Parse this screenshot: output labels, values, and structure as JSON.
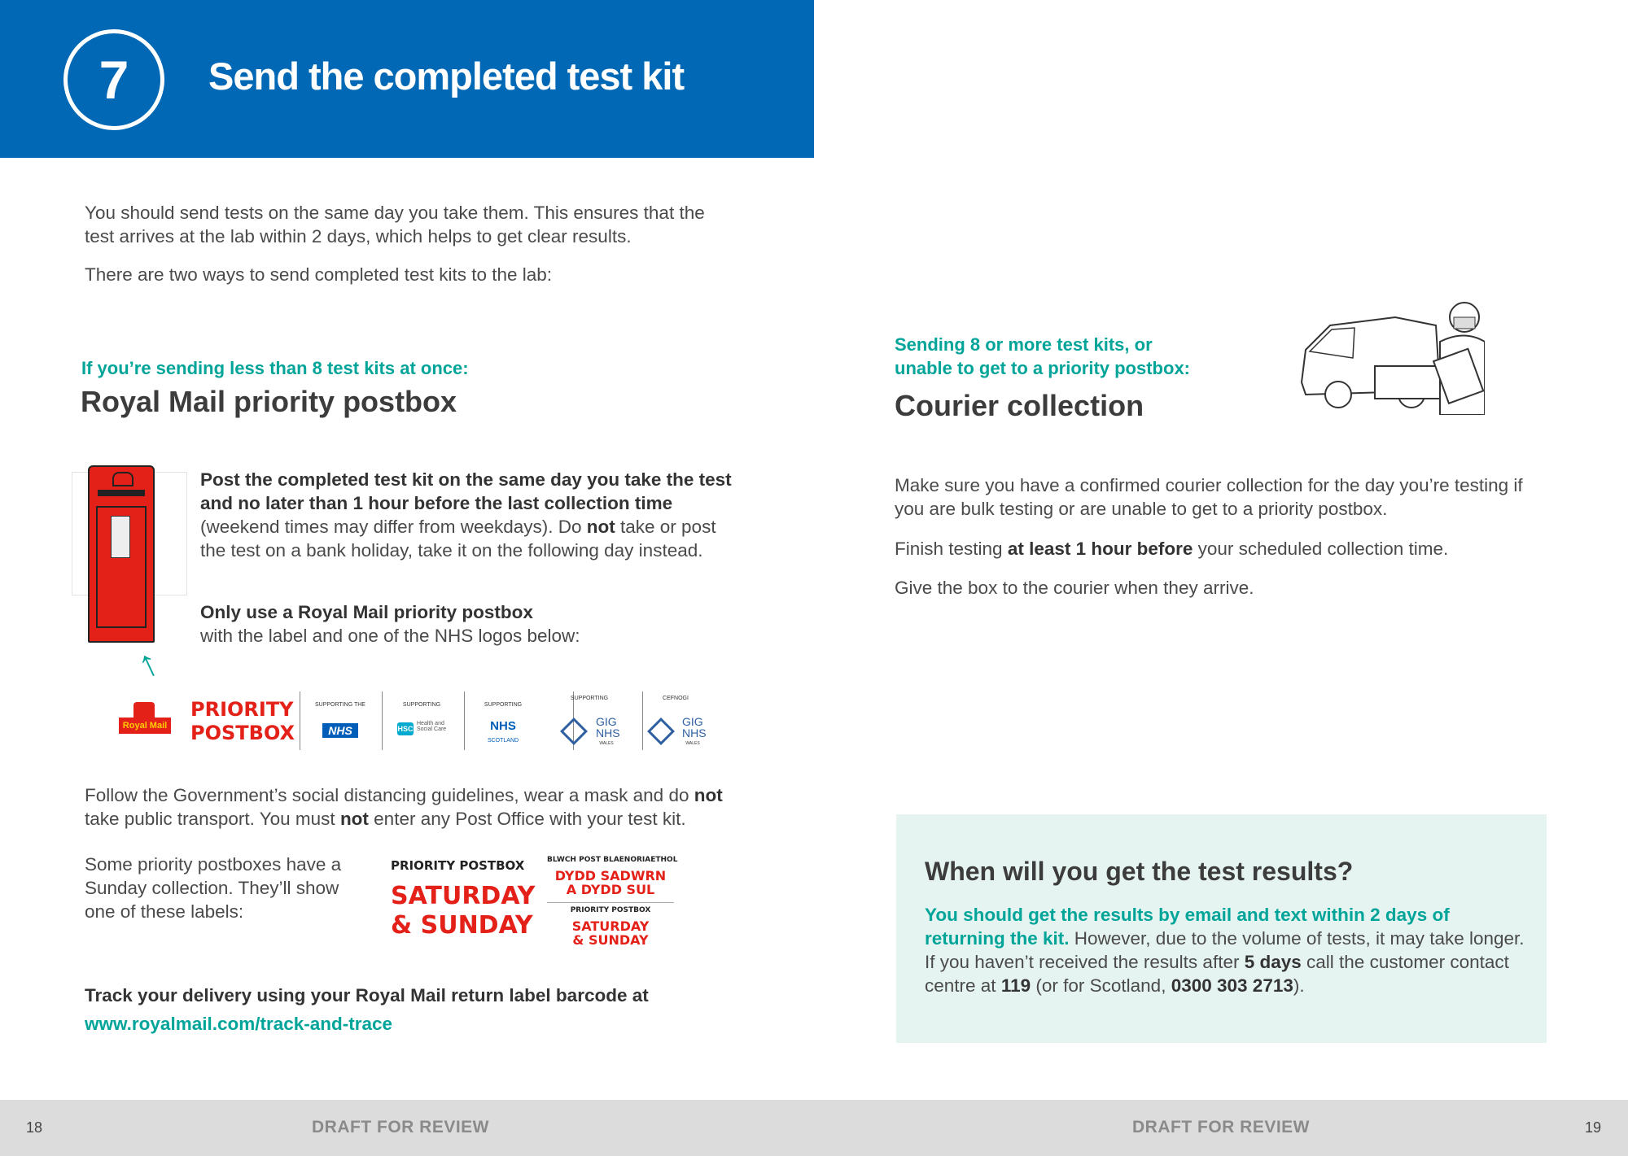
{
  "header": {
    "step_number": "7",
    "title": "Send the completed test kit"
  },
  "intro": {
    "p1": "You should send tests on the same day you take them. This ensures that the test arrives at the lab within 2 days, which helps to get clear results.",
    "p2": "There are two ways to send completed test kits to the lab:"
  },
  "postbox_section": {
    "subheading": "If you’re sending less than 8 test kits at once:",
    "heading": "Royal Mail priority postbox",
    "p1_bold": "Post the completed test kit on the same day you take the test and no later than 1 hour before the last collection time",
    "p1_a": " (weekend times may differ from weekdays). Do ",
    "p1_not": "not",
    "p1_b": " take or post the test on a bank holiday, take it on the following day instead.",
    "p2_bold": "Only use a Royal Mail priority postbox",
    "p2_rest": "with the label and one of the NHS logos below:",
    "arrow": "↑",
    "logos": {
      "royal_mail": "Royal Mail",
      "priority_line1": "PRIORITY",
      "priority_line2": "POSTBOX",
      "supporting_the": "SUPPORTING THE",
      "nhs": "NHS",
      "supporting_hsc": "SUPPORTING",
      "hsc": "HSC",
      "hsc_text": "Health and Social Care",
      "supporting_scot": "SUPPORTING",
      "nhs_scot": "NHS",
      "scotland": "SCOTLAND",
      "supporting_wales": "SUPPORTING",
      "gig": "GIG",
      "nhs_wales": "NHS",
      "wales": "WALES",
      "cefnogi": "CEFNOGI",
      "gig2": "GIG",
      "nhs_wales2": "NHS",
      "wales2": "WALES"
    },
    "p3_a": "Follow the Government’s social distancing guidelines, wear a mask and do ",
    "p3_not1": "not",
    "p3_b": " take public transport. You must ",
    "p3_not2": "not",
    "p3_c": " enter any Post Office with your test kit.",
    "sunday_text": "Some priority postboxes have a Sunday collection. They’ll show one of these labels:",
    "label_en": {
      "top": "PRIORITY POSTBOX",
      "line1": "SATURDAY",
      "line2": "& SUNDAY"
    },
    "label_cy": {
      "top": "BLWCH POST BLAENORIAETHOL",
      "line1": "DYDD SADWRN",
      "line2": "A DYDD SUL",
      "mid": "PRIORITY POSTBOX",
      "line3": "SATURDAY",
      "line4": "& SUNDAY"
    },
    "track_text": "Track your delivery using your Royal Mail return label barcode at",
    "track_link": "www.royalmail.com/track-and-trace"
  },
  "courier_section": {
    "subheading_line1": "Sending 8 or more test kits, or",
    "subheading_line2": "unable to get to a priority postbox:",
    "heading": "Courier collection",
    "p1": "Make sure you have a confirmed courier collection for the day you’re testing if you are bulk testing or are unable to get to a priority postbox.",
    "p2_a": "Finish testing ",
    "p2_bold": "at least 1 hour before",
    "p2_b": " your scheduled collection time.",
    "p3": "Give the box to the courier when they arrive."
  },
  "results_box": {
    "heading": "When will you get the test results?",
    "teal_text": "You should get the results by email and text within 2 days of returning the kit.",
    "text_a": " However, due to the volume of tests, it may take longer. If you haven’t received the results after ",
    "days": "5 days",
    "text_b": " call the customer contact centre at ",
    "num1": "119",
    "text_c": " (or for Scotland, ",
    "num2": "0300 303 2713",
    "text_d": ")."
  },
  "footer": {
    "left_page": "18",
    "left_draft": "DRAFT FOR REVIEW",
    "right_draft": "DRAFT FOR REVIEW",
    "right_page": "19"
  },
  "colors": {
    "header_blue": "#0068b4",
    "teal": "#00a499",
    "royal_mail_red": "#e32119",
    "results_bg": "#e5f4f0"
  }
}
